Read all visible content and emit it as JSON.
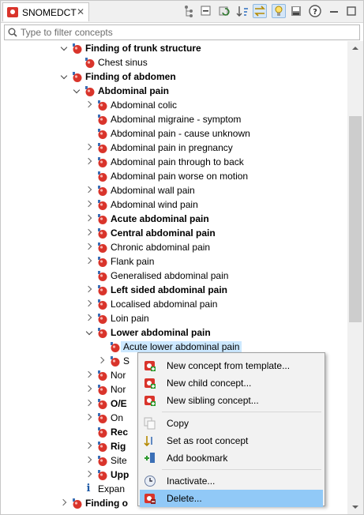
{
  "tab": {
    "title": "SNOMEDCT",
    "close_glyph": "✕",
    "icon": "snomed-icon"
  },
  "toolbar": {
    "buttons": [
      "hierarchy-icon",
      "collapse-all-icon",
      "refresh-icon",
      "sort-icon",
      "link-with-editor-icon",
      "lightbulb-icon",
      "save-icon",
      "help-icon",
      "minimize-icon",
      "maximize-icon"
    ]
  },
  "filter": {
    "placeholder": "Type to filter concepts"
  },
  "tree": {
    "rows": [
      {
        "label": "Finding of trunk structure",
        "depth": 2,
        "state": "expanded",
        "bold": true
      },
      {
        "label": "Chest sinus",
        "depth": 3,
        "state": "leaf",
        "bold": false
      },
      {
        "label": "Finding of abdomen",
        "depth": 2,
        "state": "expanded",
        "bold": true
      },
      {
        "label": "Abdominal pain",
        "depth": 3,
        "state": "expanded",
        "bold": true
      },
      {
        "label": "Abdominal colic",
        "depth": 4,
        "state": "collapsed",
        "bold": false
      },
      {
        "label": "Abdominal migraine - symptom",
        "depth": 4,
        "state": "leaf",
        "bold": false
      },
      {
        "label": "Abdominal pain - cause unknown",
        "depth": 4,
        "state": "leaf",
        "bold": false
      },
      {
        "label": "Abdominal pain in pregnancy",
        "depth": 4,
        "state": "collapsed",
        "bold": false
      },
      {
        "label": "Abdominal pain through to back",
        "depth": 4,
        "state": "collapsed",
        "bold": false
      },
      {
        "label": "Abdominal pain worse on motion",
        "depth": 4,
        "state": "leaf",
        "bold": false
      },
      {
        "label": "Abdominal wall pain",
        "depth": 4,
        "state": "collapsed",
        "bold": false
      },
      {
        "label": "Abdominal wind pain",
        "depth": 4,
        "state": "collapsed",
        "bold": false
      },
      {
        "label": "Acute abdominal pain",
        "depth": 4,
        "state": "collapsed",
        "bold": true
      },
      {
        "label": "Central abdominal pain",
        "depth": 4,
        "state": "collapsed",
        "bold": true
      },
      {
        "label": "Chronic abdominal pain",
        "depth": 4,
        "state": "collapsed",
        "bold": false
      },
      {
        "label": "Flank pain",
        "depth": 4,
        "state": "collapsed",
        "bold": false
      },
      {
        "label": "Generalised abdominal pain",
        "depth": 4,
        "state": "leaf",
        "bold": false
      },
      {
        "label": "Left sided abdominal pain",
        "depth": 4,
        "state": "collapsed",
        "bold": true
      },
      {
        "label": "Localised abdominal pain",
        "depth": 4,
        "state": "collapsed",
        "bold": false
      },
      {
        "label": "Loin pain",
        "depth": 4,
        "state": "collapsed",
        "bold": false
      },
      {
        "label": "Lower abdominal pain",
        "depth": 4,
        "state": "expanded",
        "bold": true
      },
      {
        "label": "Acute lower abdominal pain",
        "depth": 5,
        "state": "leaf",
        "bold": false,
        "selected": true
      },
      {
        "label": "S",
        "depth": 5,
        "state": "collapsed",
        "bold": false
      },
      {
        "label": "Nor",
        "depth": 4,
        "state": "collapsed",
        "bold": false
      },
      {
        "label": "Nor",
        "depth": 4,
        "state": "collapsed",
        "bold": false
      },
      {
        "label": "O/E",
        "depth": 4,
        "state": "collapsed",
        "bold": true
      },
      {
        "label": "On",
        "depth": 4,
        "state": "collapsed",
        "bold": false
      },
      {
        "label": "Rec",
        "depth": 4,
        "state": "leaf",
        "bold": true
      },
      {
        "label": "Rig",
        "depth": 4,
        "state": "collapsed",
        "bold": true
      },
      {
        "label": "Site",
        "depth": 4,
        "state": "collapsed",
        "bold": false
      },
      {
        "label": "Upp",
        "depth": 4,
        "state": "collapsed",
        "bold": true
      },
      {
        "label": "Expan",
        "depth": 3,
        "state": "info",
        "bold": false
      },
      {
        "label": "Finding o",
        "depth": 2,
        "state": "collapsed",
        "bold": true
      }
    ]
  },
  "menu": {
    "items": [
      {
        "label": "New concept from template...",
        "icon": "new-concept-icon",
        "sep_before": false
      },
      {
        "label": "New child concept...",
        "icon": "new-child-icon",
        "sep_before": false
      },
      {
        "label": "New sibling concept...",
        "icon": "new-sibling-icon",
        "sep_before": false
      },
      {
        "label": "Copy",
        "icon": "copy-icon",
        "sep_before": true
      },
      {
        "label": "Set as root concept",
        "icon": "set-root-icon",
        "sep_before": false
      },
      {
        "label": "Add bookmark",
        "icon": "bookmark-icon",
        "sep_before": false
      },
      {
        "label": "Inactivate...",
        "icon": "inactivate-icon",
        "sep_before": true
      },
      {
        "label": "Delete...",
        "icon": "delete-icon",
        "sep_before": false,
        "highlighted": true
      }
    ]
  },
  "colors": {
    "selection": "#cce8ff",
    "menu_highlight": "#91c9f7",
    "concept_red": "#d9342b",
    "concept_blue": "#3b6fb6"
  }
}
